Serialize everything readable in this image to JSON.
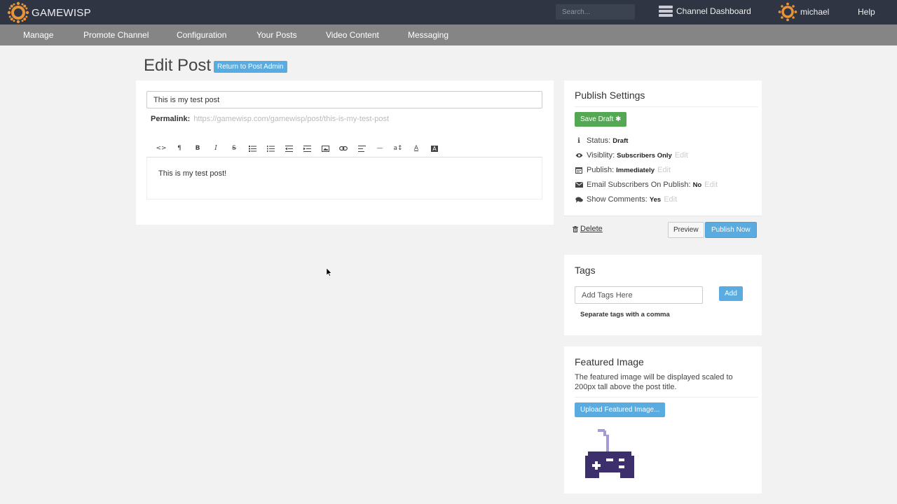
{
  "app": {
    "brand": "GAMEWISP",
    "search_placeholder": "Search...",
    "channel_dashboard": "Channel Dashboard",
    "username": "michael",
    "help": "Help"
  },
  "nav": {
    "items": [
      "Manage",
      "Promote Channel",
      "Configuration",
      "Your Posts",
      "Video Content",
      "Messaging"
    ]
  },
  "page": {
    "title": "Edit Post",
    "return_button": "Return to Post Admin"
  },
  "editor": {
    "title_value": "This is my test post",
    "permalink_label": "Permalink:",
    "permalink_url": "https://gamewisp.com/gamewisp/post/this-is-my-test-post",
    "toolbar": [
      "html-icon",
      "paragraph-icon",
      "bold-icon",
      "italic-icon",
      "strikethrough-icon",
      "unordered-list-icon",
      "ordered-list-icon",
      "outdent-icon",
      "indent-icon",
      "image-icon",
      "link-icon",
      "align-icon",
      "horizontal-rule-icon",
      "font-size-icon",
      "font-color-icon",
      "background-color-icon"
    ],
    "body_text": "This is my test post!"
  },
  "publish": {
    "heading": "Publish Settings",
    "save_draft": "Save Draft",
    "status_label": "Status:",
    "status_value": "Draft",
    "visibility_label": "Visiblity:",
    "visibility_value": "Subscribers Only",
    "publish_label": "Publish:",
    "publish_value": "Immediately",
    "email_label": "Email Subscribers On Publish:",
    "email_value": "No",
    "comments_label": "Show Comments:",
    "comments_value": "Yes",
    "edit": "Edit",
    "delete": "Delete",
    "preview": "Preview",
    "publish_now": "Publish Now"
  },
  "tags": {
    "heading": "Tags",
    "placeholder": "Add Tags Here",
    "add": "Add",
    "hint": "Separate tags with a comma"
  },
  "featured": {
    "heading": "Featured Image",
    "description": "The featured image will be displayed scaled to 200px tall above the post title.",
    "upload": "Upload Featured Image..."
  },
  "colors": {
    "topbar": "#2f3542",
    "nav": "#858585",
    "accent": "#5aabdf",
    "success": "#54a854",
    "controller": "#3d2f6b",
    "cord": "#a79ad6"
  }
}
